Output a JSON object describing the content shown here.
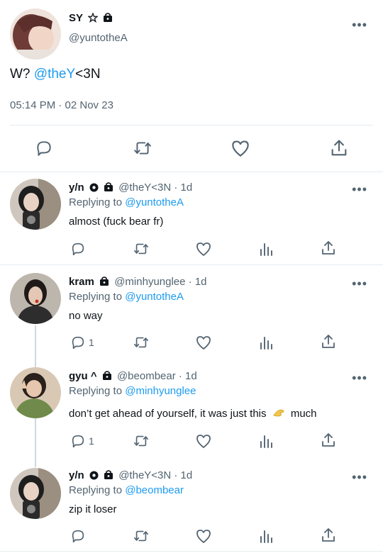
{
  "main_tweet": {
    "display_name": "SY",
    "handle": "@yuntotheA",
    "text_prefix": "W? ",
    "mention": "@theY",
    "text_suffix": "<3N",
    "timestamp": "05:14 PM · 02 Nov 23"
  },
  "replies": [
    {
      "display_name": "y/n",
      "handle_time": "@theY<3N · 1d",
      "replying_prefix": "Replying to ",
      "replying_to": "@yuntotheA",
      "text": "almost (fuck bear fr)",
      "reply_count": ""
    },
    {
      "display_name": "kram",
      "handle_time": "@minhyunglee · 1d",
      "replying_prefix": "Replying to ",
      "replying_to": "@yuntotheA",
      "text": "no way",
      "reply_count": "1"
    },
    {
      "display_name": "gyu ^",
      "handle_time": "@beombear · 1d",
      "replying_prefix": "Replying to ",
      "replying_to": "@minhyunglee",
      "text": "don’t get ahead of yourself, it was just this",
      "text_after": "much",
      "reply_count": "1"
    },
    {
      "display_name": "y/n",
      "handle_time": "@theY<3N · 1d",
      "replying_prefix": "Replying to ",
      "replying_to": "@beombear",
      "text": "zip it loser",
      "reply_count": ""
    }
  ],
  "more_label": "•••",
  "colors": {
    "link": "#1d9bf0",
    "muted": "#536471",
    "text": "#0f1419"
  },
  "icons": [
    "reply-icon",
    "retweet-icon",
    "like-icon",
    "views-icon",
    "share-icon",
    "lock-icon",
    "star-icon",
    "gear-badge-icon",
    "pinch-hand-emoji"
  ]
}
